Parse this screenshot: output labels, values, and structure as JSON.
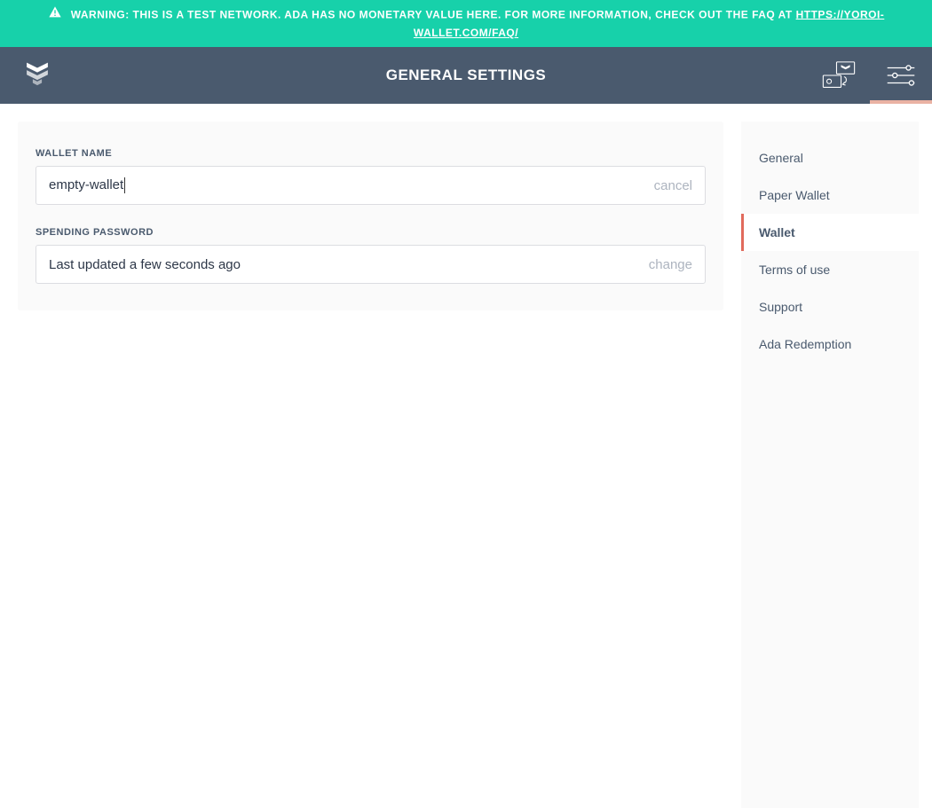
{
  "warning": {
    "text_before": "WARNING: THIS IS A TEST NETWORK. ADA HAS NO MONETARY VALUE HERE. FOR MORE INFORMATION, CHECK OUT THE FAQ AT ",
    "link_text": "HTTPS://YOROI-WALLET.COM/FAQ/"
  },
  "header": {
    "title": "GENERAL SETTINGS"
  },
  "main": {
    "wallet_name_label": "WALLET NAME",
    "wallet_name_value": "empty-wallet",
    "wallet_name_action": "cancel",
    "spending_password_label": "SPENDING PASSWORD",
    "spending_password_value": "Last updated a few seconds ago",
    "spending_password_action": "change"
  },
  "sidebar": {
    "items": [
      {
        "label": "General",
        "active": false
      },
      {
        "label": "Paper Wallet",
        "active": false
      },
      {
        "label": "Wallet",
        "active": true
      },
      {
        "label": "Terms of use",
        "active": false
      },
      {
        "label": "Support",
        "active": false
      },
      {
        "label": "Ada Redemption",
        "active": false
      }
    ]
  }
}
